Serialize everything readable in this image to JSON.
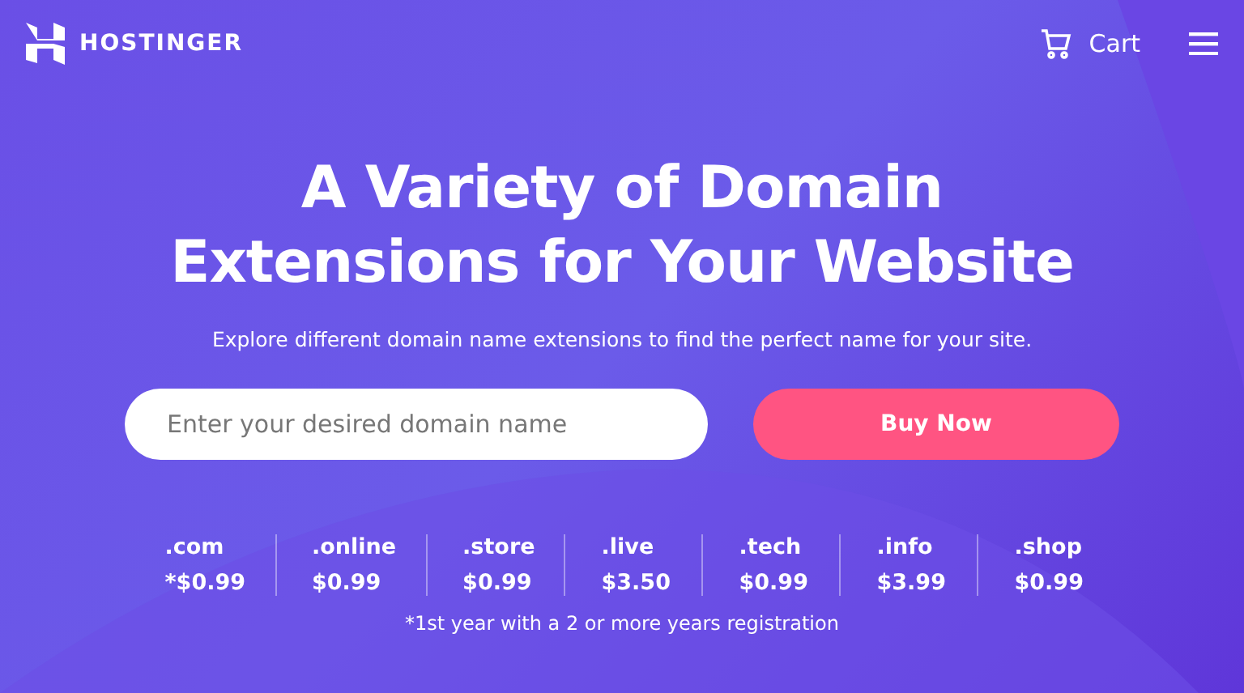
{
  "header": {
    "logo": "HOSTINGER",
    "cart": "Cart"
  },
  "hero": {
    "title_lines": [
      "A Variety of Domain",
      "Extensions for Your Website"
    ],
    "subtitle": "Explore different domain name extensions to find the perfect name for your site."
  },
  "search": {
    "placeholder": "Enter your desired domain name",
    "button": "Buy Now"
  },
  "extensions": [
    {
      "name": ".com",
      "price": "*$0.99"
    },
    {
      "name": ".online",
      "price": "$0.99"
    },
    {
      "name": ".store",
      "price": "$0.99"
    },
    {
      "name": ".live",
      "price": "$3.50"
    },
    {
      "name": ".tech",
      "price": "$0.99"
    },
    {
      "name": ".info",
      "price": "$3.99"
    },
    {
      "name": ".shop",
      "price": "$0.99"
    }
  ],
  "footnote": "*1st year with a 2 or more years registration"
}
